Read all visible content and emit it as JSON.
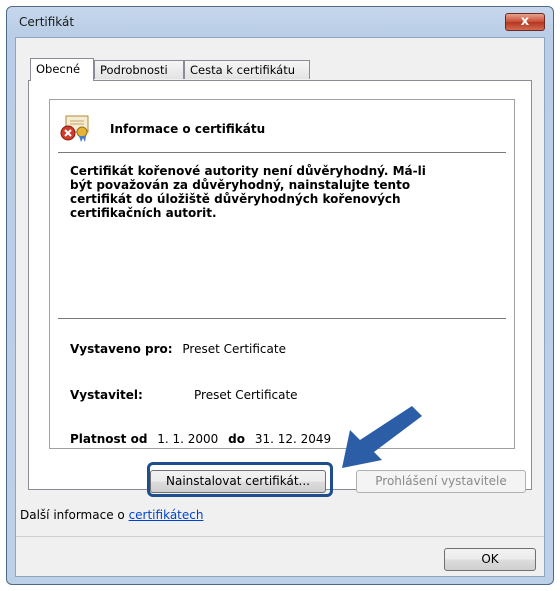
{
  "window": {
    "title": "Certifikát",
    "close_glyph": "x"
  },
  "tabs": [
    {
      "label": "Obecné",
      "active": true
    },
    {
      "label": "Podrobnosti",
      "active": false
    },
    {
      "label": "Cesta k certifikátu",
      "active": false
    }
  ],
  "info": {
    "title": "Informace o certifikátu",
    "warning_lines": [
      "Certifikát kořenové autority není důvěryhodný. Má-li",
      "být považován za důvěryhodný, nainstalujte tento",
      "certifikát do úložiště důvěryhodných kořenových",
      "certifikačních autorit."
    ],
    "issued_to_label": "Vystaveno pro:",
    "issued_to_value": "Preset Certificate",
    "issuer_label": "Vystavitel:",
    "issuer_value": "Preset Certificate",
    "valid_from_label": "Platnost od",
    "valid_from_value": "1. 1. 2000",
    "valid_to_label": "do",
    "valid_to_value": "31. 12. 2049"
  },
  "buttons": {
    "install": "Nainstalovat certifikát...",
    "issuer_statement": "Prohlášení vystavitele",
    "ok": "OK"
  },
  "more_info": {
    "prefix": "Další informace o ",
    "link": "certifikátech"
  },
  "colors": {
    "highlight": "#1f4e8c",
    "arrow": "#2c5ea8"
  }
}
